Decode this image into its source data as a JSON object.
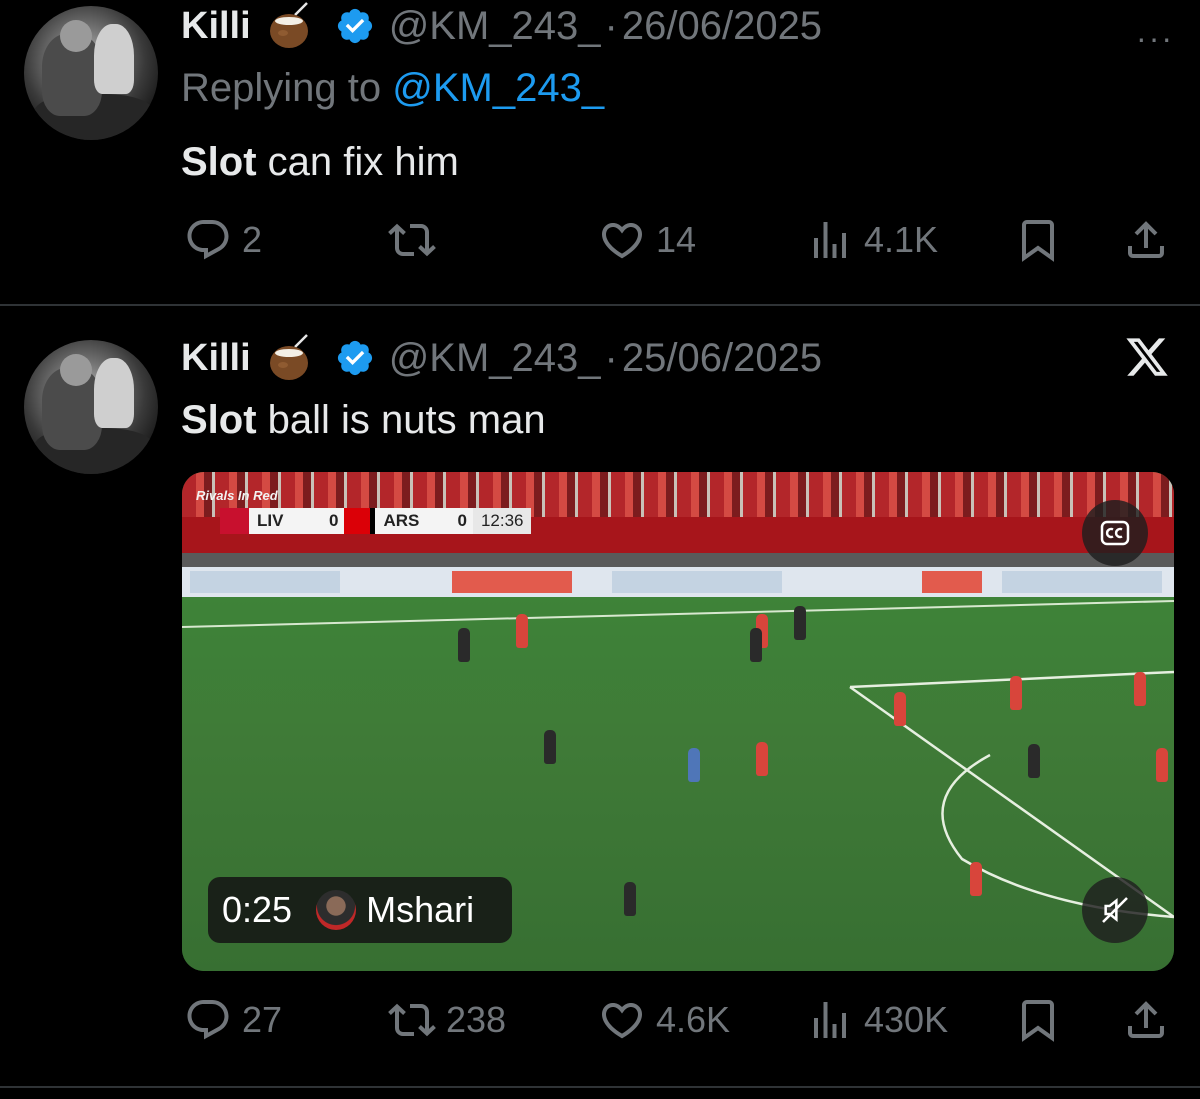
{
  "tweets": [
    {
      "name": "Killi",
      "handle": "@KM_243_",
      "separator": "·",
      "date": "26/06/2025",
      "replying_prefix": "Replying to ",
      "replying_to": "@KM_243_",
      "text_bold": "Slot",
      "text_rest": " can fix him",
      "replies": "2",
      "reposts": "",
      "likes": "14",
      "views": "4.1K"
    },
    {
      "name": "Killi",
      "handle": "@KM_243_",
      "separator": "·",
      "date": "25/06/2025",
      "text_bold": "Slot",
      "text_rest": " ball is nuts man",
      "replies": "27",
      "reposts": "238",
      "likes": "4.6K",
      "views": "430K",
      "video": {
        "duration": "0:25",
        "uploader": "Mshari",
        "overlay_label": "Rivals In Red",
        "scoreboard": {
          "home": "LIV",
          "home_score": "0",
          "away": "ARS",
          "away_score": "0",
          "clock": "12:36"
        }
      }
    }
  ],
  "icons": {
    "more": "more-icon",
    "x_logo": "x-logo-icon",
    "reply": "reply-icon",
    "repost": "repost-icon",
    "like": "like-icon",
    "views": "views-icon",
    "bookmark": "bookmark-icon",
    "share": "share-icon",
    "cc": "cc-icon",
    "mute": "mute-icon"
  },
  "more_label": "···",
  "colors": {
    "background": "#000000",
    "text": "#e7e9ea",
    "muted": "#71767b",
    "link": "#1d9bf0",
    "divider": "#2f3336",
    "verified": "#1d9bf0"
  }
}
